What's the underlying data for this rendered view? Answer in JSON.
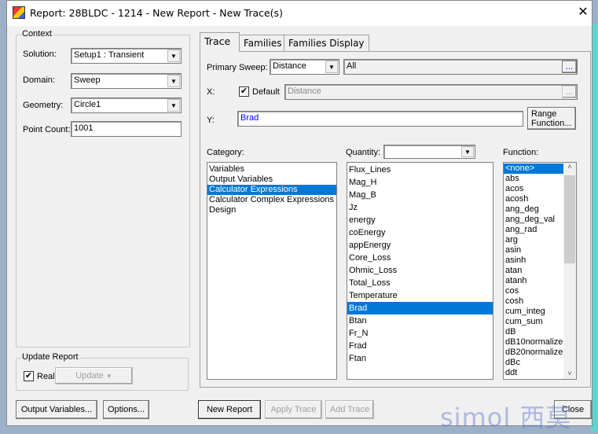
{
  "window": {
    "title": "Report: 28BLDC - 1214 - New Report - New Trace(s)",
    "close": "✕"
  },
  "context": {
    "group_label": "Context",
    "solution_label": "Solution:",
    "solution_value": "Setup1 : Transient",
    "domain_label": "Domain:",
    "domain_value": "Sweep",
    "geometry_label": "Geometry:",
    "geometry_value": "Circle1",
    "point_count_label": "Point Count:",
    "point_count_value": "1001"
  },
  "update_report": {
    "group_label": "Update Report",
    "realtime_label": "Real time",
    "realtime_checked": true,
    "update_button": "Update"
  },
  "tabs": [
    {
      "label": "Trace",
      "active": true
    },
    {
      "label": "Families"
    },
    {
      "label": "Families Display"
    }
  ],
  "trace": {
    "primary_sweep_label": "Primary Sweep:",
    "primary_sweep_value": "Distance",
    "sweep_range": "All",
    "browse": "...",
    "x_label": "X:",
    "default_label": "Default",
    "default_checked": true,
    "x_value": "Distance",
    "y_label": "Y:",
    "y_value": "Brad",
    "range_function_line1": "Range",
    "range_function_line2": "Function...",
    "category_label": "Category:",
    "quantity_label": "Quantity:",
    "quantity_filter": "",
    "function_label": "Function:",
    "categories": [
      {
        "label": "Variables"
      },
      {
        "label": "Output Variables"
      },
      {
        "label": "Calculator Expressions",
        "selected": true
      },
      {
        "label": "Calculator Complex Expressions"
      },
      {
        "label": "Design"
      }
    ],
    "quantities": [
      {
        "label": "Flux_Lines"
      },
      {
        "label": "Mag_H"
      },
      {
        "label": "Mag_B"
      },
      {
        "label": "Jz"
      },
      {
        "label": "energy"
      },
      {
        "label": "coEnergy"
      },
      {
        "label": "appEnergy"
      },
      {
        "label": "Core_Loss"
      },
      {
        "label": "Ohmic_Loss"
      },
      {
        "label": "Total_Loss"
      },
      {
        "label": "Temperature"
      },
      {
        "label": "Brad",
        "selected": true
      },
      {
        "label": "Btan"
      },
      {
        "label": "Fr_N"
      },
      {
        "label": "Frad"
      },
      {
        "label": "Ftan"
      }
    ],
    "functions": [
      {
        "label": "<none>",
        "selected": true
      },
      {
        "label": "abs"
      },
      {
        "label": "acos"
      },
      {
        "label": "acosh"
      },
      {
        "label": "ang_deg"
      },
      {
        "label": "ang_deg_val"
      },
      {
        "label": "ang_rad"
      },
      {
        "label": "arg"
      },
      {
        "label": "asin"
      },
      {
        "label": "asinh"
      },
      {
        "label": "atan"
      },
      {
        "label": "atanh"
      },
      {
        "label": "cos"
      },
      {
        "label": "cosh"
      },
      {
        "label": "cum_integ"
      },
      {
        "label": "cum_sum"
      },
      {
        "label": "dB"
      },
      {
        "label": "dB10normalize"
      },
      {
        "label": "dB20normalize"
      },
      {
        "label": "dBc"
      },
      {
        "label": "ddt"
      }
    ]
  },
  "buttons": {
    "output_variables": "Output Variables...",
    "options": "Options...",
    "new_report": "New Report",
    "apply_trace": "Apply Trace",
    "add_trace": "Add Trace",
    "close": "Close"
  },
  "watermark": "simol 西莫",
  "colors": {
    "selection": "#0078d7",
    "y_expression": "#0000ff"
  }
}
